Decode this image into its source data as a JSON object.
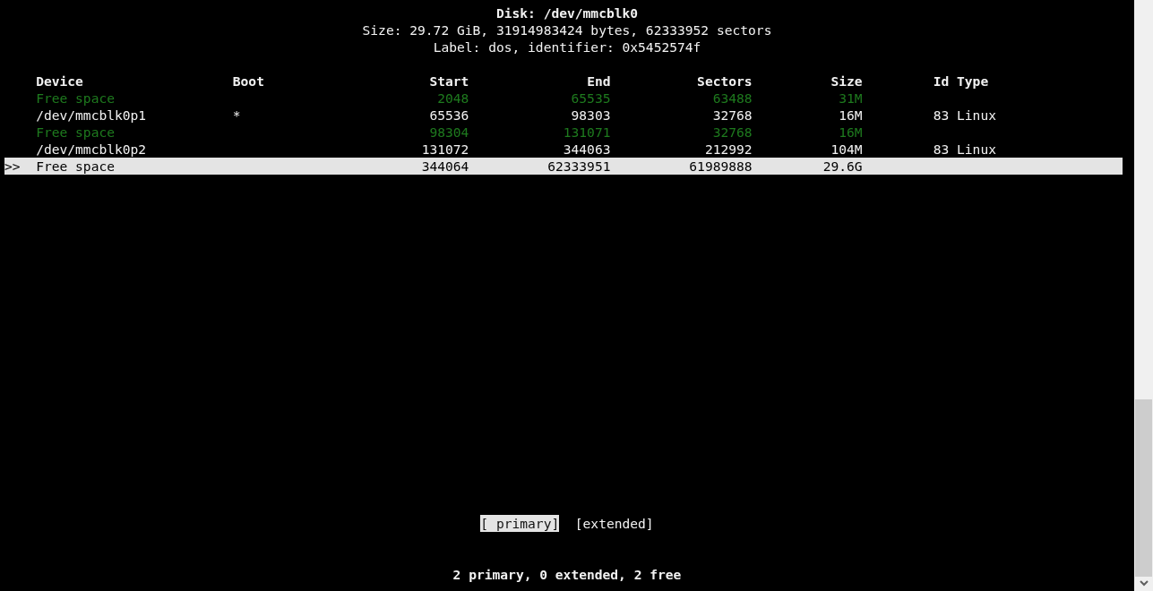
{
  "header": {
    "title": "Disk: /dev/mmcblk0",
    "size": "Size: 29.72 GiB, 31914983424 bytes, 62333952 sectors",
    "label": "Label: dos, identifier: 0x5452574f"
  },
  "table": {
    "columns": [
      "Device",
      "Boot",
      "Start",
      "End",
      "Sectors",
      "Size",
      "Id Type"
    ],
    "rows": [
      {
        "kind": "free",
        "selected": false,
        "cells": [
          "Free space",
          "",
          "2048",
          "65535",
          "63488",
          "31M",
          ""
        ]
      },
      {
        "kind": "partition",
        "selected": false,
        "cells": [
          "/dev/mmcblk0p1",
          "*",
          "65536",
          "98303",
          "32768",
          "16M",
          "83 Linux"
        ]
      },
      {
        "kind": "free",
        "selected": false,
        "cells": [
          "Free space",
          "",
          "98304",
          "131071",
          "32768",
          "16M",
          ""
        ]
      },
      {
        "kind": "partition",
        "selected": false,
        "cells": [
          "/dev/mmcblk0p2",
          "",
          "131072",
          "344063",
          "212992",
          "104M",
          "83 Linux"
        ]
      },
      {
        "kind": "free",
        "selected": true,
        "marker": ">>",
        "cells": [
          "Free space",
          "",
          "344064",
          "62333951",
          "61989888",
          "29.6G",
          ""
        ]
      }
    ]
  },
  "buttons": [
    {
      "label": "[ primary]",
      "selected": true
    },
    {
      "label": "[extended]",
      "selected": false
    }
  ],
  "status": "2 primary, 0 extended, 2 free"
}
